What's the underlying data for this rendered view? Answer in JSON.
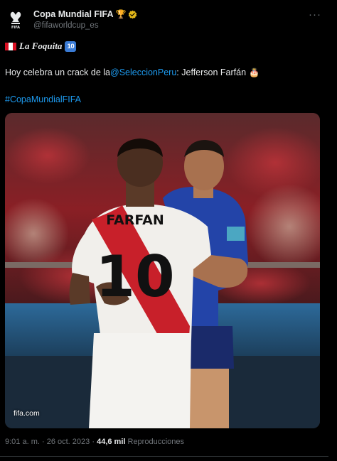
{
  "author": {
    "name": "Copa Mundial FIFA",
    "handle": "@fifaworldcup_es",
    "name_emoji": "🏆",
    "verified_badge": "verified-gold-icon",
    "avatar_icon": "fifa-world-cup-logo"
  },
  "tweet": {
    "line1_title": "La Foquita",
    "line1_badge": "10",
    "line1_flag": "peru-flag",
    "line2_prefix": "Hoy celebra un crack de la ",
    "line2_mention": "@SeleccionPeru",
    "line2_suffix": ": Jefferson Farfán",
    "line2_emoji": "🎂",
    "hashtag": "#CopaMundialFIFA"
  },
  "media": {
    "jersey_name": "FARFAN",
    "jersey_number": "10",
    "source_label": "fifa.com"
  },
  "meta": {
    "time": "9:01 a. m.",
    "separator": "·",
    "date": "26 oct. 2023",
    "separator2": "·",
    "views_count": "44,6 mil",
    "views_label": "Reproducciones"
  },
  "colors": {
    "background": "#000000",
    "text": "#e7e9ea",
    "muted": "#71767b",
    "link": "#1d9bf0",
    "peru_red": "#d91023",
    "france_blue": "#1f3b8c"
  }
}
